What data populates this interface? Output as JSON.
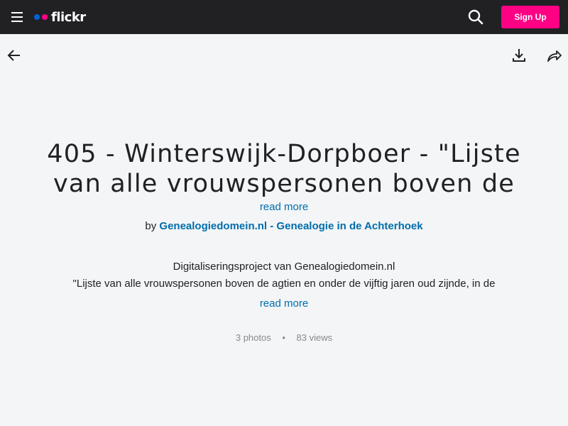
{
  "header": {
    "logo_text": "flickr",
    "signup_label": "Sign Up",
    "icons": {
      "menu": "hamburger-menu-icon",
      "search": "search-icon"
    }
  },
  "toolbar": {
    "icons": {
      "back": "back-arrow-icon",
      "download": "download-icon",
      "share": "share-icon"
    }
  },
  "album": {
    "title": "405 - Winterswijk-Dorpboer - \"Lijste van alle vrouwspersonen boven de",
    "title_read_more": "read more",
    "by_label": "by",
    "owner": "Genealogiedomein.nl - Genealogie in de Achterhoek",
    "description_lines": [
      "Digitaliseringsproject van Genealogiedomein.nl",
      "\"Lijste van alle vrouwspersonen boven de agtien en onder de vijftig jaren oud zijnde, in de"
    ],
    "description_read_more": "read more",
    "photos": "3 photos",
    "separator": "•",
    "views": "83 views"
  },
  "colors": {
    "header_bg": "#212124",
    "page_bg": "#f3f5f6",
    "signup_bg": "#ff0084",
    "link": "#006dac",
    "logo_blue": "#0063dc",
    "logo_pink": "#ff0084"
  }
}
